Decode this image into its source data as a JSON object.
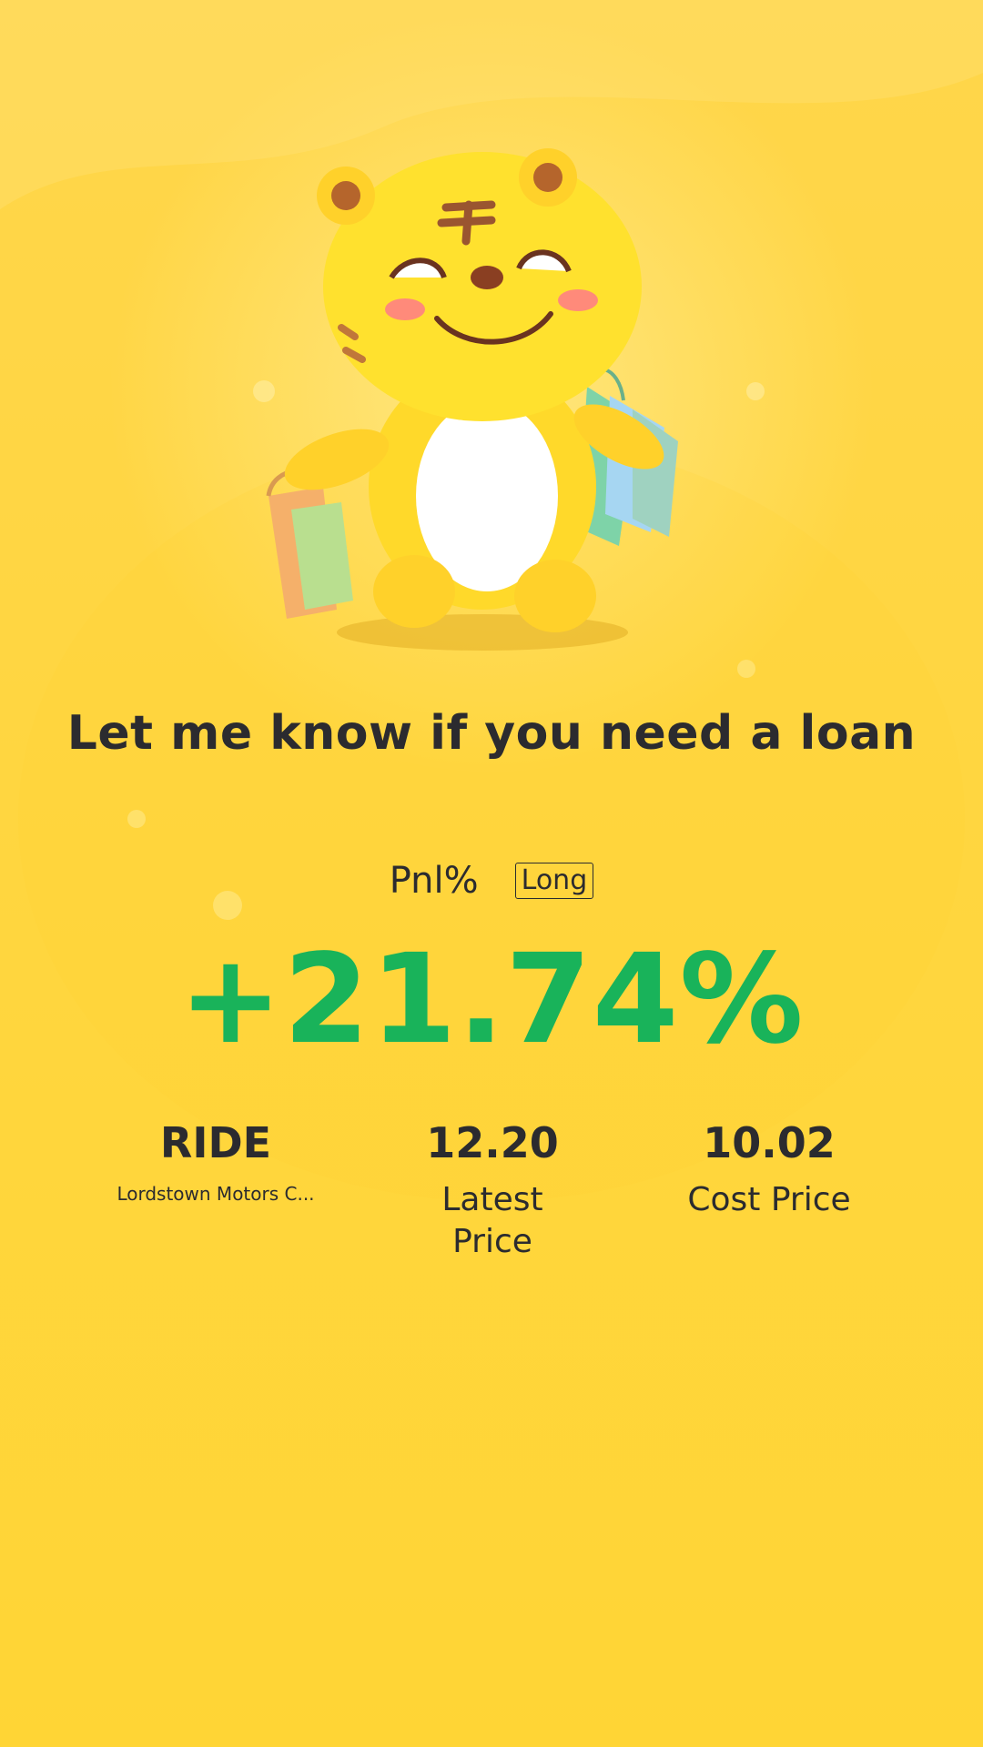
{
  "headline": "Let me know if you need a loan",
  "pnl": {
    "label": "Pnl%",
    "badge": "Long",
    "value": "+21.74%",
    "value_color": "#19b35a"
  },
  "stats": {
    "ticker": {
      "symbol": "RIDE",
      "name": "Lordstown Motors C..."
    },
    "latest": {
      "value": "12.20",
      "label": "Latest Price"
    },
    "cost": {
      "value": "10.02",
      "label": "Cost Price"
    }
  },
  "mascot": {
    "icon": "tiger-mascot-with-shopping-bags-icon"
  },
  "colors": {
    "background": "#ffd640",
    "text": "#2b2b2f",
    "profit": "#19b35a"
  }
}
